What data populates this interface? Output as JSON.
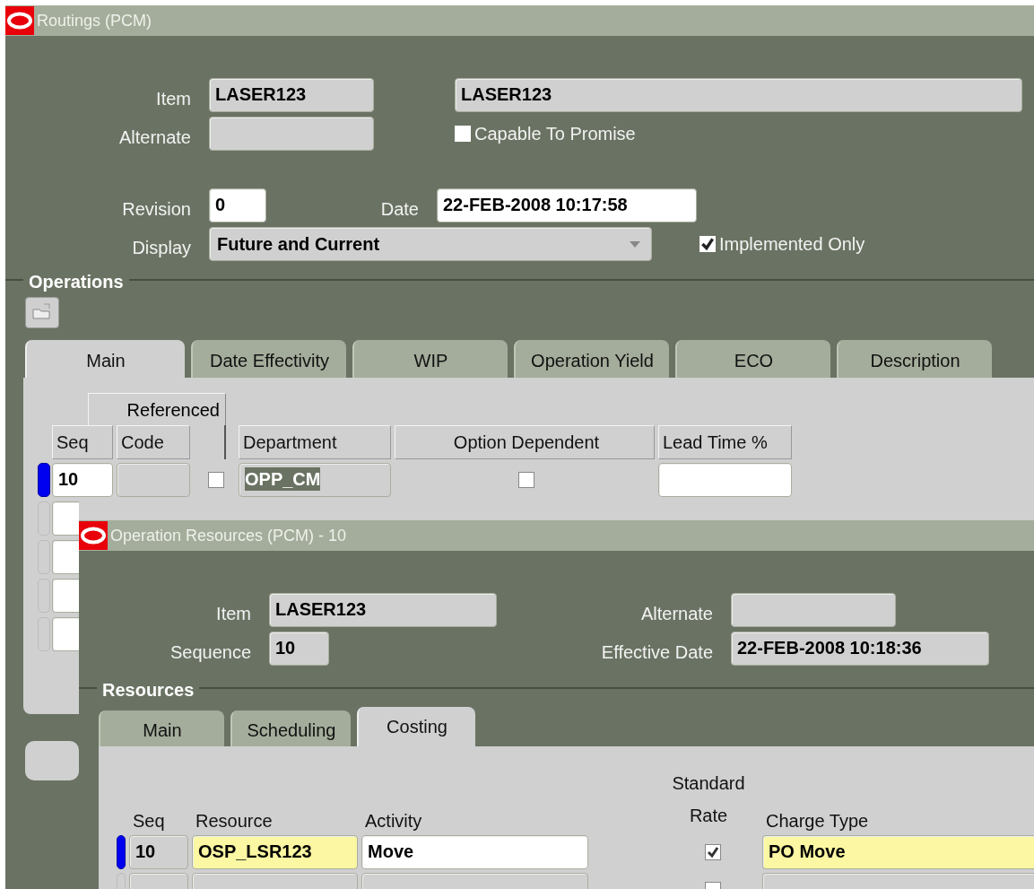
{
  "routings_window": {
    "title": "Routings (PCM)",
    "item": {
      "label": "Item",
      "value": "LASER123",
      "description": "LASER123"
    },
    "alternate": {
      "label": "Alternate"
    },
    "capable_to_promise": {
      "label": "Capable To Promise",
      "checked": false
    },
    "revision": {
      "label": "Revision",
      "value": "0"
    },
    "date": {
      "label": "Date",
      "value": "22-FEB-2008 10:17:58"
    },
    "display": {
      "label": "Display",
      "value": "Future and Current"
    },
    "implemented_only": {
      "label": "Implemented Only",
      "checked": true
    },
    "operations": {
      "title": "Operations",
      "tabs": [
        {
          "label": "Main",
          "selected": true
        },
        {
          "label": "Date Effectivity",
          "selected": false
        },
        {
          "label": "WIP",
          "selected": false
        },
        {
          "label": "Operation Yield",
          "selected": false
        },
        {
          "label": "ECO",
          "selected": false
        },
        {
          "label": "Description",
          "selected": false
        }
      ],
      "group_header": "Referenced",
      "columns": [
        "Seq",
        "Code",
        "Department",
        "Option Dependent",
        "Lead Time %"
      ],
      "rows": [
        {
          "seq": "10",
          "referenced": false,
          "department": "OPP_CM",
          "department_highlighted": true,
          "option_dependent": false,
          "selected": true
        }
      ]
    }
  },
  "resources_window": {
    "title": "Operation Resources (PCM) - 10",
    "item": {
      "label": "Item",
      "value": "LASER123"
    },
    "alternate": {
      "label": "Alternate"
    },
    "sequence": {
      "label": "Sequence",
      "value": "10"
    },
    "effective_date": {
      "label": "Effective Date",
      "value": "22-FEB-2008 10:18:36"
    },
    "resources": {
      "title": "Resources",
      "tabs": [
        {
          "label": "Main",
          "selected": false
        },
        {
          "label": "Scheduling",
          "selected": false
        },
        {
          "label": "Costing",
          "selected": true
        }
      ],
      "columns": [
        "Seq",
        "Resource",
        "Activity",
        "Standard Rate",
        "Charge Type"
      ],
      "rows": [
        {
          "seq": "10",
          "resource": "OSP_LSR123",
          "activity": "Move",
          "standard_rate": true,
          "charge_type": "PO Move",
          "selected": true
        },
        {
          "standard_rate": false,
          "selected": false
        }
      ]
    }
  }
}
